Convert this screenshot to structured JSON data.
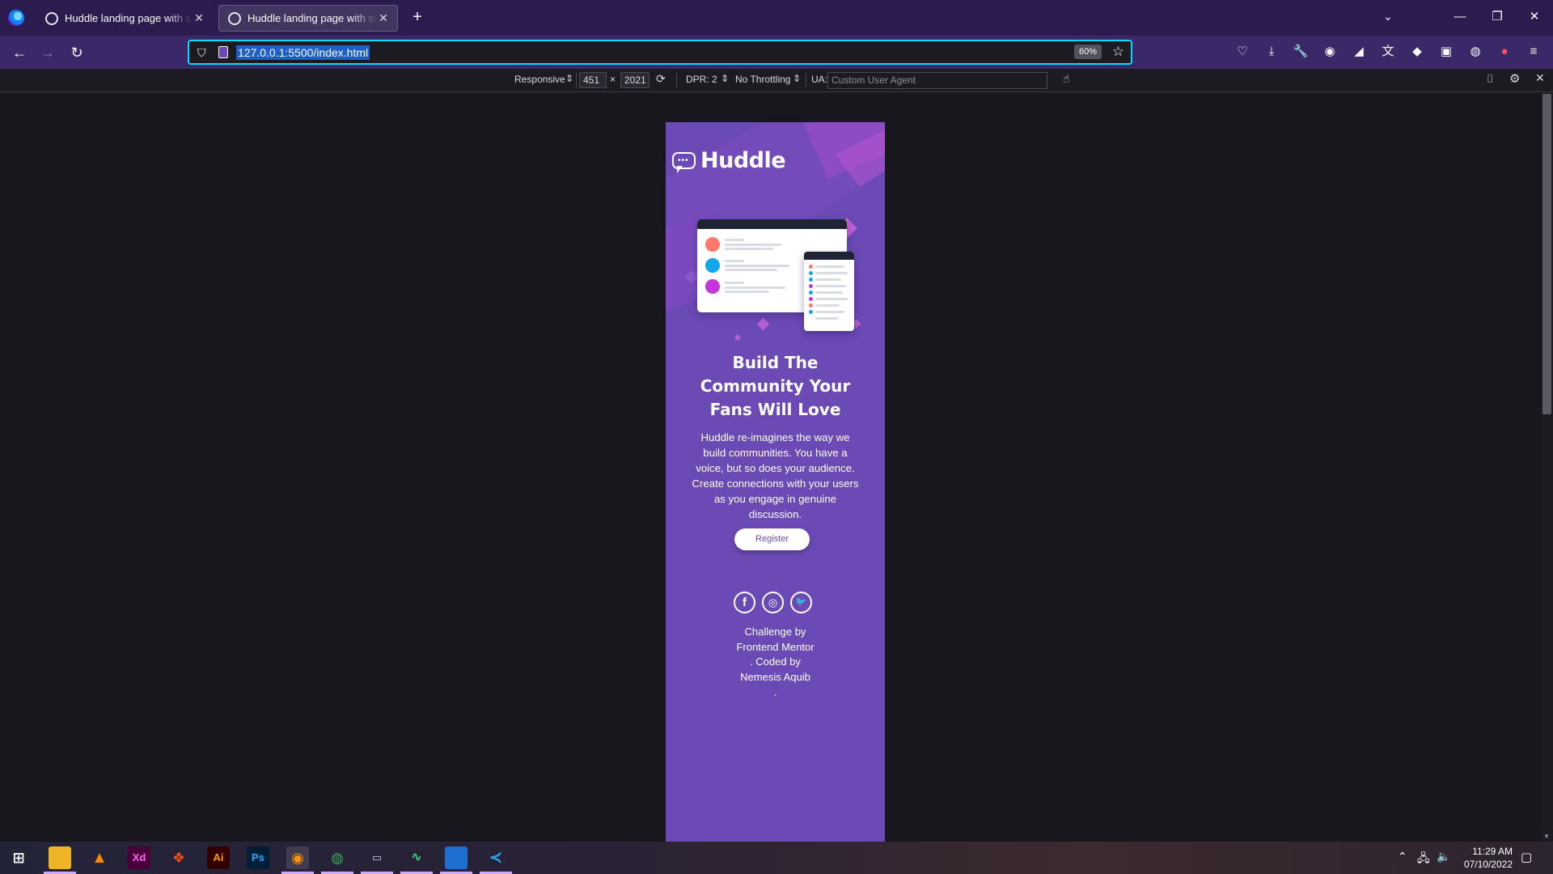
{
  "browser": {
    "tabs": [
      {
        "title": "Huddle landing page with single introductory section"
      },
      {
        "title": "Huddle landing page with single introductory section"
      }
    ],
    "new_tab_label": "+",
    "url": "127.0.0.1:5500/index.html",
    "zoom": "60%"
  },
  "responsive_toolbar": {
    "device": "Responsive",
    "width": "451",
    "times": "×",
    "height": "2021",
    "dpr": "DPR: 2",
    "throttling": "No Throttling",
    "ua_label": "UA:",
    "ua_placeholder": "Custom User Agent"
  },
  "huddle": {
    "brand": "Huddle",
    "headline": [
      "Build The",
      "Community Your",
      "Fans Will Love"
    ],
    "description": "Huddle re-imagines the way we build communities. You have a voice, but so does your audience. Create connections with your users as you engage in genuine discussion.",
    "register_label": "Register",
    "socials": [
      {
        "icon": "facebook-icon",
        "glyph": "f"
      },
      {
        "icon": "instagram-icon",
        "glyph": "◎"
      },
      {
        "icon": "twitter-icon",
        "glyph": "🐦"
      }
    ],
    "attribution": [
      "Challenge by",
      "Frontend Mentor",
      ". Coded by",
      "Nemesis Aquib",
      "."
    ],
    "colors": {
      "background": "#6b4ab5",
      "accent": "#d67bdb",
      "text": "#ffffff"
    }
  },
  "taskbar": {
    "apps": [
      "windows-start-icon",
      "file-explorer-icon",
      "vlc-icon",
      "adobe-xd-icon",
      "figma-icon",
      "illustrator-icon",
      "photoshop-icon",
      "firefox-icon",
      "chrome-icon",
      "generic-app-icon",
      "activity-monitor-icon",
      "photos-icon",
      "vscode-icon"
    ],
    "xd_label": "Xd",
    "ai_label": "Ai",
    "ps_label": "Ps",
    "time": "11:29 AM",
    "date": "07/10/2022"
  }
}
